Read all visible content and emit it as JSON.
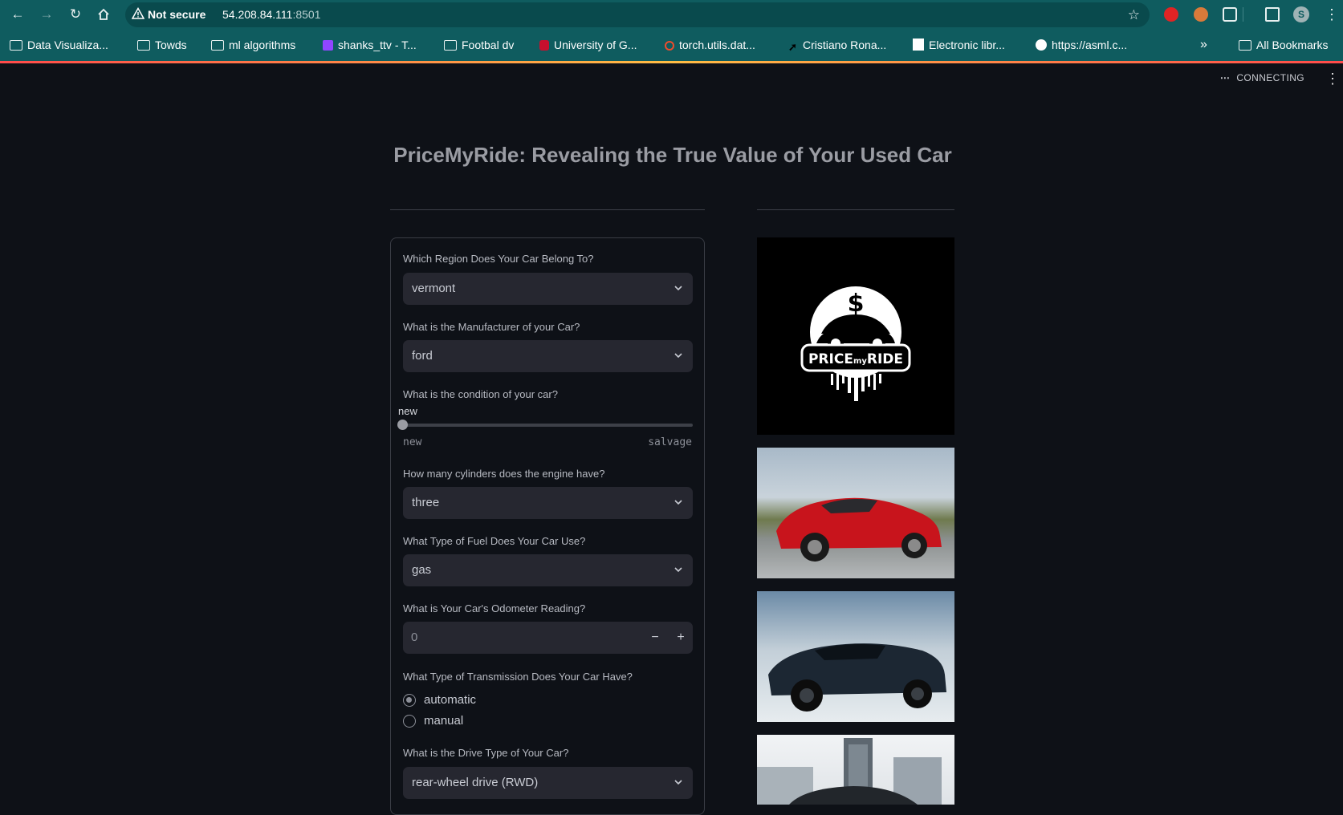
{
  "browser": {
    "security_label": "Not secure",
    "url_host": "54.208.84.111",
    "url_port": ":8501",
    "bookmarks": [
      {
        "label": "Data Visualiza...",
        "icon": "folder-icon"
      },
      {
        "label": "Towds",
        "icon": "folder-icon"
      },
      {
        "label": "ml algorithms",
        "icon": "folder-icon"
      },
      {
        "label": "shanks_ttv - T...",
        "icon": "twitch-icon"
      },
      {
        "label": "Footbal dv",
        "icon": "folder-icon"
      },
      {
        "label": "University of G...",
        "icon": "university-icon"
      },
      {
        "label": "torch.utils.dat...",
        "icon": "pytorch-icon"
      },
      {
        "label": "Cristiano Rona...",
        "icon": "cr7-icon"
      },
      {
        "label": "Electronic libr...",
        "icon": "library-icon"
      },
      {
        "label": "https://asml.c...",
        "icon": "globe-icon"
      }
    ],
    "bookmarks_overflow": "»",
    "all_bookmarks": "All Bookmarks",
    "profile_initial": "S"
  },
  "app": {
    "status": "CONNECTING",
    "title": "PriceMyRide: Revealing the True Value of Your Used Car",
    "logo_text": "PRICE my RIDE",
    "form": {
      "region": {
        "label": "Which Region Does Your Car Belong To?",
        "value": "vermont"
      },
      "manufacturer": {
        "label": "What is the Manufacturer of your Car?",
        "value": "ford"
      },
      "condition": {
        "label": "What is the condition of your car?",
        "value": "new",
        "min": "new",
        "max": "salvage",
        "position": 0
      },
      "cylinders": {
        "label": "How many cylinders does the engine have?",
        "value": "three"
      },
      "fuel": {
        "label": "What Type of Fuel Does Your Car Use?",
        "value": "gas"
      },
      "odometer": {
        "label": "What is Your Car's Odometer Reading?",
        "value": "0",
        "minus": "−",
        "plus": "+"
      },
      "transmission": {
        "label": "What Type of Transmission Does Your Car Have?",
        "options": [
          "automatic",
          "manual"
        ],
        "selected": "automatic"
      },
      "drive": {
        "label": "What is the Drive Type of Your Car?",
        "value": "rear-wheel drive (RWD)"
      }
    }
  },
  "colors": {
    "browser_chrome": "#0f5c5f",
    "app_bg": "#0e1117",
    "widget_bg": "#262730"
  }
}
